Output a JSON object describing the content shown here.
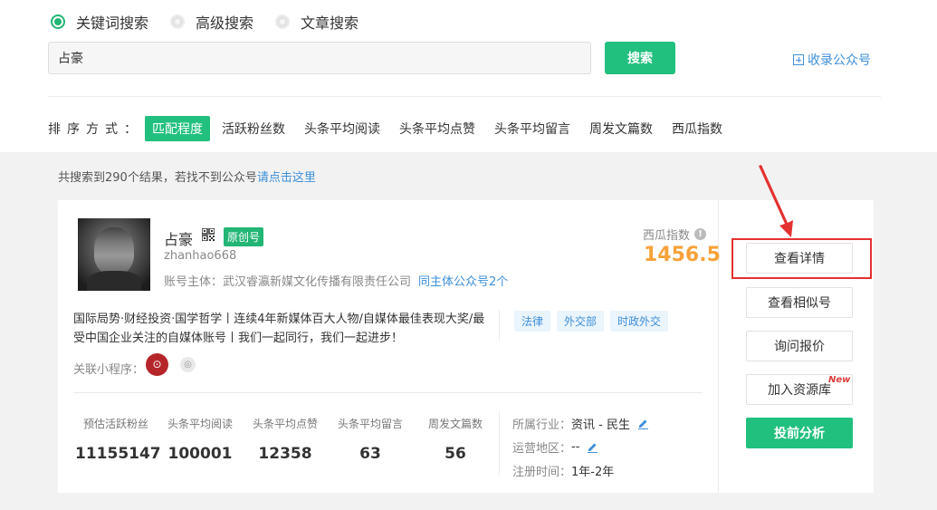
{
  "search_modes": [
    {
      "label": "关键词搜索",
      "selected": true
    },
    {
      "label": "高级搜索",
      "selected": false
    },
    {
      "label": "文章搜索",
      "selected": false
    }
  ],
  "search": {
    "value": "占豪",
    "button_label": "搜索"
  },
  "collect_link": "收录公众号",
  "sort": {
    "label": "排序方式：",
    "items": [
      "匹配程度",
      "活跃粉丝数",
      "头条平均阅读",
      "头条平均点赞",
      "头条平均留言",
      "周发文篇数",
      "西瓜指数"
    ],
    "active_index": 0
  },
  "result": {
    "count_text": "共搜索到290个结果，若找不到公众号",
    "link_text": "请点击这里"
  },
  "account": {
    "name": "占豪",
    "badge": "原创号",
    "id": "zhanhao668",
    "owner_label": "账号主体：武汉睿瀛新媒文化传播有限责任公司",
    "same_owner_link": "同主体公众号2个",
    "xigua_label": "西瓜指数",
    "xigua_value": "1456.5",
    "description": "国际局势·财经投资·国学哲学丨连续4年新媒体百大人物/自媒体最佳表现大奖/最受中国企业关注的自媒体账号丨我们一起同行，我们一起进步！",
    "tags": [
      "法律",
      "外交部",
      "时政外交"
    ],
    "mini_program_label": "关联小程序：",
    "stats": [
      {
        "label": "预估活跃粉丝",
        "value": "11155147"
      },
      {
        "label": "头条平均阅读",
        "value": "100001"
      },
      {
        "label": "头条平均点赞",
        "value": "12358"
      },
      {
        "label": "头条平均留言",
        "value": "63"
      },
      {
        "label": "周发文篇数",
        "value": "56"
      }
    ],
    "industry_label": "所属行业：",
    "industry_value": "资讯 - 民生",
    "region_label": "运营地区：",
    "region_value": "--",
    "register_label": "注册时间：",
    "register_value": "1年-2年"
  },
  "actions": {
    "detail": "查看详情",
    "similar": "查看相似号",
    "quote": "询问报价",
    "add_library": "加入资源库",
    "new_badge": "New",
    "analysis": "投前分析"
  },
  "colors": {
    "accent": "#22c07e",
    "link": "#3d8fd9",
    "xigua": "#f7a23b",
    "highlight": "#e53030"
  }
}
